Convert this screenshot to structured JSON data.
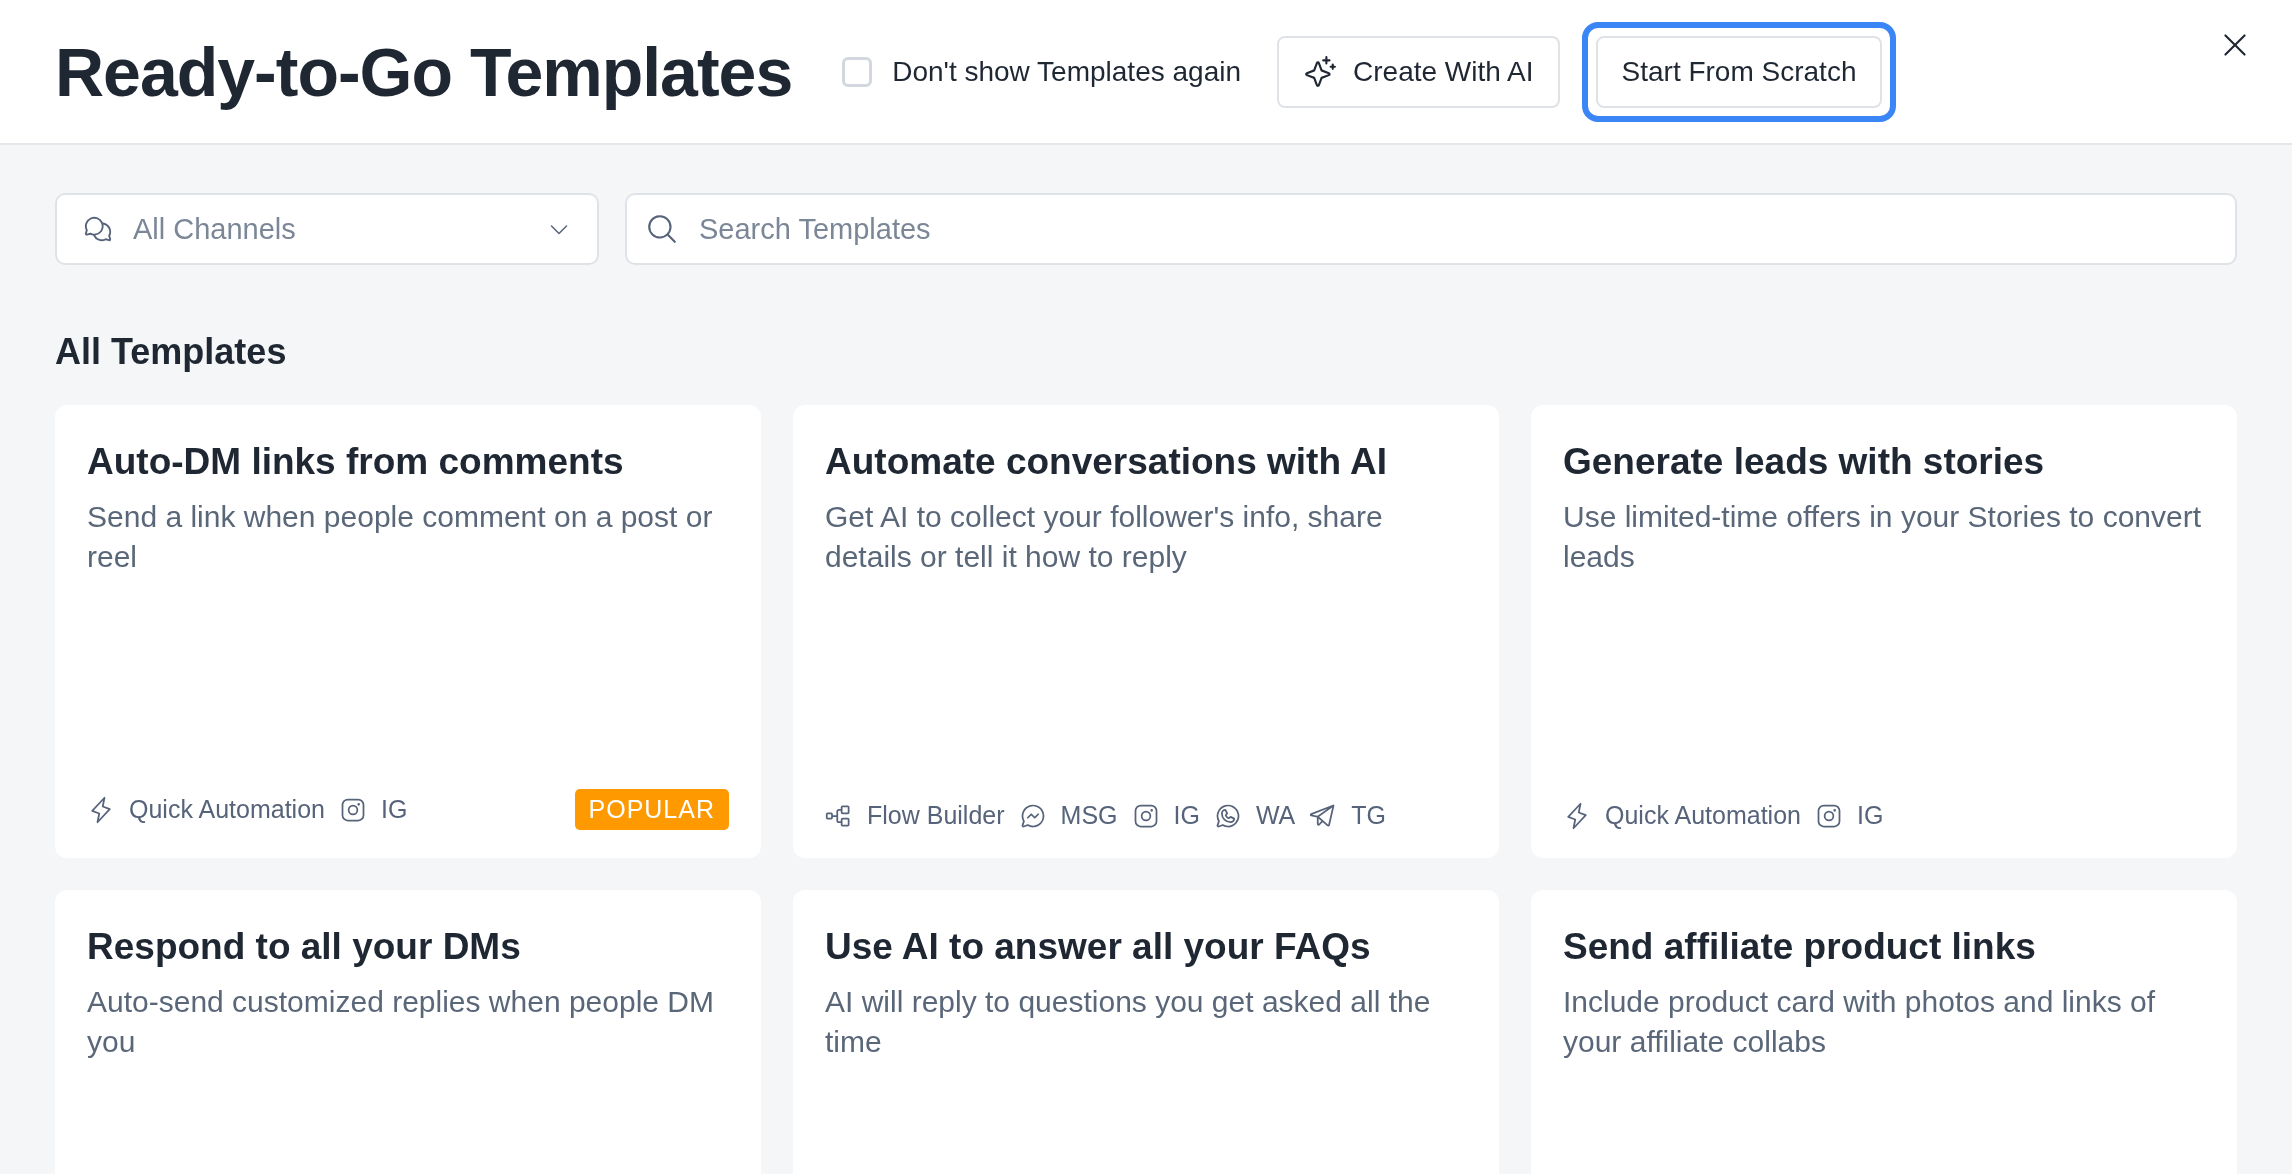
{
  "header": {
    "title": "Ready-to-Go Templates",
    "checkbox": {
      "label": "Don't show Templates again",
      "checked": false
    },
    "buttons": [
      {
        "label": "Create With AI",
        "kind": "ai",
        "focused": false
      },
      {
        "label": "Start From Scratch",
        "kind": "plain",
        "focused": true
      }
    ]
  },
  "filters": {
    "channel_select": {
      "value": "All Channels"
    },
    "search": {
      "placeholder": "Search Templates"
    }
  },
  "section_title": "All Templates",
  "cards": [
    {
      "title": "Auto-DM links from comments",
      "description": "Send a link when people comment on a post or reel",
      "tags": [
        {
          "kind": "quick",
          "label": "Quick Automation"
        },
        {
          "kind": "instagram",
          "label": "IG"
        }
      ],
      "badge": "POPULAR"
    },
    {
      "title": "Automate conversations with AI",
      "description": "Get AI to collect your follower's info, share details or tell it how to reply",
      "tags": [
        {
          "kind": "flow",
          "label": "Flow Builder"
        },
        {
          "kind": "messenger",
          "label": "MSG"
        },
        {
          "kind": "instagram",
          "label": "IG"
        },
        {
          "kind": "whatsapp",
          "label": "WA"
        },
        {
          "kind": "telegram",
          "label": "TG"
        }
      ]
    },
    {
      "title": "Generate leads with stories",
      "description": "Use limited-time offers in your Stories to convert leads",
      "tags": [
        {
          "kind": "quick",
          "label": "Quick Automation"
        },
        {
          "kind": "instagram",
          "label": "IG"
        }
      ]
    },
    {
      "title": "Respond to all your DMs",
      "description": "Auto-send customized replies when people DM you"
    },
    {
      "title": "Use AI to answer all your FAQs",
      "description": "AI will reply to questions you get asked all the time"
    },
    {
      "title": "Send affiliate product links",
      "description": "Include product card with photos and links of your affiliate collabs"
    }
  ]
}
